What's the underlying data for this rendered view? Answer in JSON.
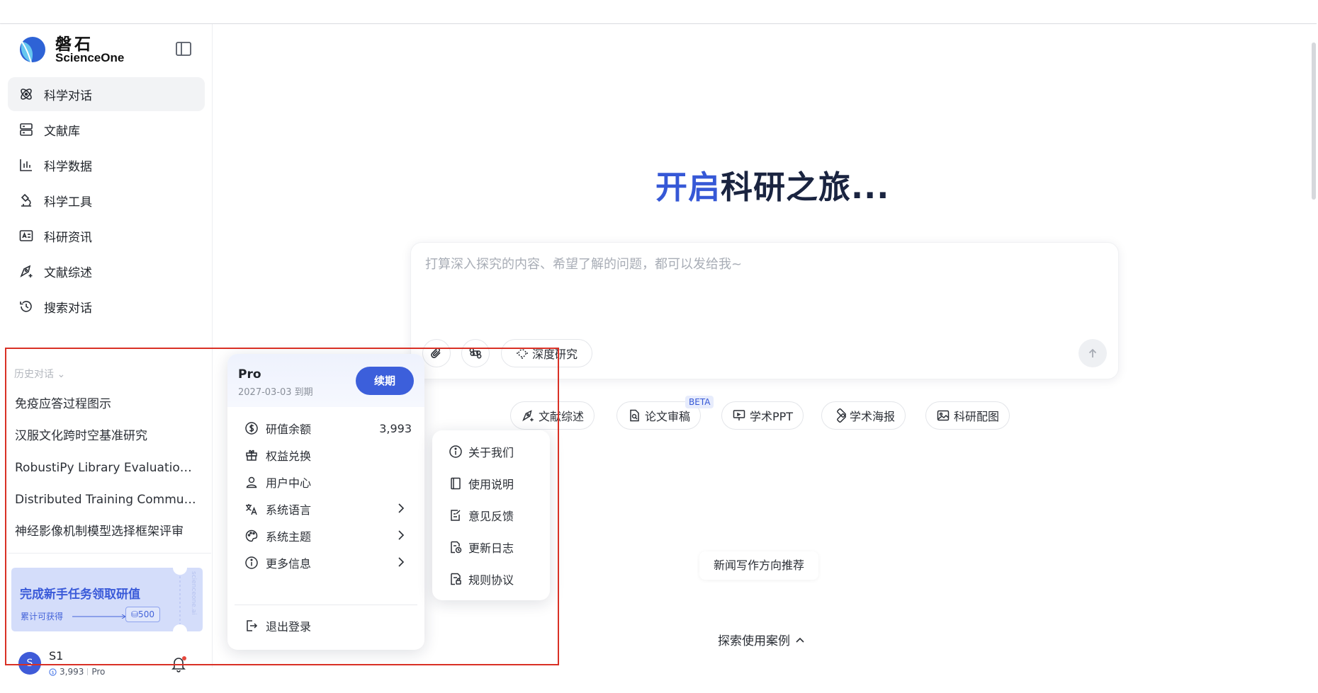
{
  "brand": {
    "name_zh": "磐石",
    "name_en": "ScienceOne"
  },
  "nav": [
    {
      "label": "科学对话",
      "icon": "atom-icon",
      "active": true
    },
    {
      "label": "文献库",
      "icon": "library-icon",
      "active": false
    },
    {
      "label": "科学数据",
      "icon": "data-chart-icon",
      "active": false
    },
    {
      "label": "科学工具",
      "icon": "microscope-icon",
      "active": false
    },
    {
      "label": "科研资讯",
      "icon": "news-icon",
      "active": false
    },
    {
      "label": "文献综述",
      "icon": "pen-nib-icon",
      "active": false
    },
    {
      "label": "搜索对话",
      "icon": "history-icon",
      "active": false
    }
  ],
  "history": {
    "title": "历史对话",
    "items": [
      "免疫应答过程图示",
      "汉服文化跨时空基准研究",
      "RobustiPy Library Evaluation Re...",
      "Distributed Training Communic...",
      "神经影像机制模型选择框架评审"
    ]
  },
  "promo": {
    "title": "完成新手任务领取研值",
    "subtitle": "累计可获得",
    "badge": "⛁500",
    "side_text": "scienceone.ai"
  },
  "user": {
    "avatar_letter": "S",
    "name": "S1",
    "balance": "3,993",
    "plan": "Pro"
  },
  "hero": {
    "part1": "开启",
    "part2": "科研之旅..."
  },
  "composer": {
    "placeholder": "打算深入探究的内容、希望了解的问题，都可以发给我~",
    "deep_research": "深度研究"
  },
  "chips": [
    {
      "label": "文献综述",
      "icon": "pen-nib-icon"
    },
    {
      "label": "论文审稿",
      "icon": "doc-search-icon"
    },
    {
      "label": "学术PPT",
      "icon": "presentation-icon"
    },
    {
      "label": "学术海报",
      "icon": "poster-icon"
    },
    {
      "label": "科研配图",
      "icon": "image-icon"
    }
  ],
  "beta_label": "BETA",
  "news_rec": "新闻写作方向推荐",
  "explore": "探索使用案例",
  "popover": {
    "plan": "Pro",
    "expiry": "2027-03-03 到期",
    "renew": "续期",
    "items": [
      {
        "label": "研值余额",
        "value": "3,993",
        "icon": "coin-icon"
      },
      {
        "label": "权益兑换",
        "icon": "gift-icon"
      },
      {
        "label": "用户中心",
        "icon": "user-icon"
      },
      {
        "label": "系统语言",
        "icon": "translate-icon",
        "has_sub": true
      },
      {
        "label": "系统主题",
        "icon": "palette-icon",
        "has_sub": true
      },
      {
        "label": "更多信息",
        "icon": "info-icon",
        "has_sub": true
      }
    ],
    "logout": "退出登录"
  },
  "submenu": [
    {
      "label": "关于我们",
      "icon": "info-icon"
    },
    {
      "label": "使用说明",
      "icon": "book-icon"
    },
    {
      "label": "意见反馈",
      "icon": "feedback-icon"
    },
    {
      "label": "更新日志",
      "icon": "changelog-icon"
    },
    {
      "label": "规则协议",
      "icon": "agreement-icon"
    }
  ],
  "colors": {
    "accent": "#3c5fdb",
    "annotation": "#d93025"
  }
}
